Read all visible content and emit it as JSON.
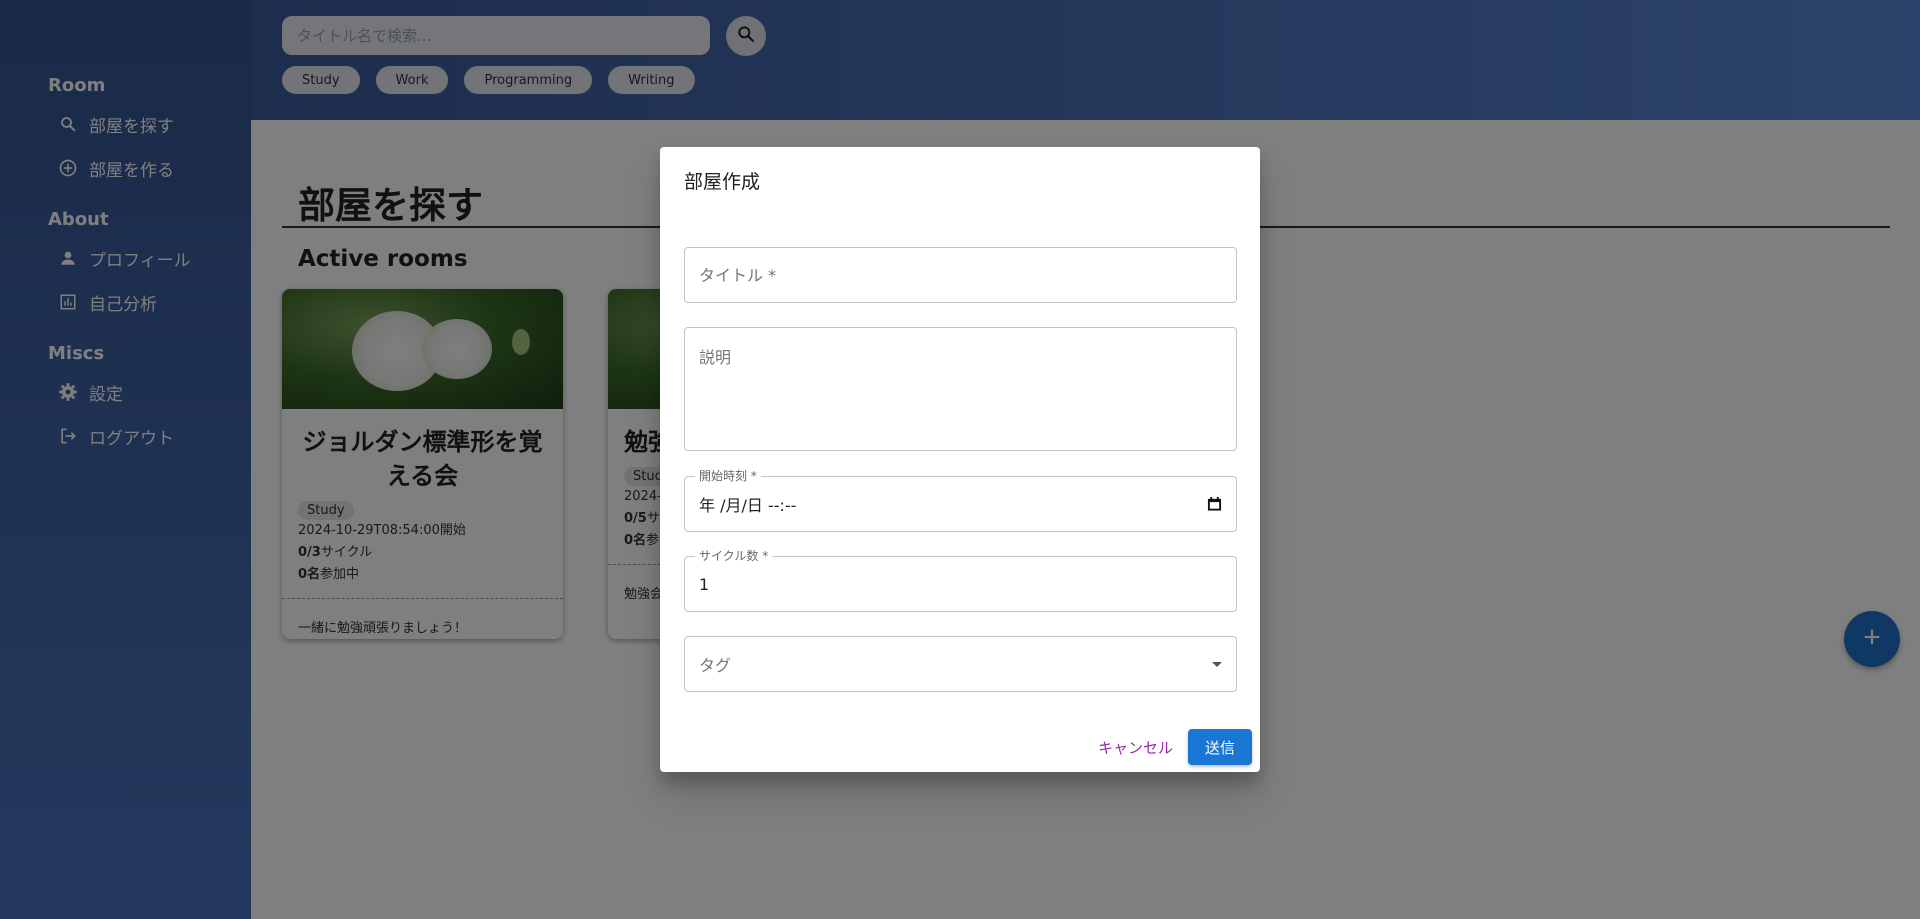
{
  "sidebar": {
    "groups": [
      {
        "heading": "Room",
        "items": [
          {
            "label": "部屋を探す",
            "icon": "search-icon"
          },
          {
            "label": "部屋を作る",
            "icon": "add-circle-icon"
          }
        ]
      },
      {
        "heading": "About",
        "items": [
          {
            "label": "プロフィール",
            "icon": "person-icon"
          },
          {
            "label": "自己分析",
            "icon": "chart-icon"
          }
        ]
      },
      {
        "heading": "Miscs",
        "items": [
          {
            "label": "設定",
            "icon": "gear-icon"
          },
          {
            "label": "ログアウト",
            "icon": "logout-icon"
          }
        ]
      }
    ]
  },
  "topbar": {
    "search_placeholder": "タイトル名で検索...",
    "tags": [
      "Study",
      "Work",
      "Programming",
      "Writing"
    ]
  },
  "main": {
    "page_title": "部屋を探す",
    "section_title": "Active rooms",
    "cards": [
      {
        "title": "ジョルダン標準形を覚える会",
        "tag": "Study",
        "start": "2024-10-29T08:54:00開始",
        "cycles_count": "0/3",
        "cycles_suffix": "サイクル",
        "participants_count": "0名",
        "participants_suffix": "参加中",
        "description": "一緒に勉強頑張りましょう！"
      },
      {
        "title": "勉強",
        "tag": "Stud",
        "start": "2024-",
        "cycles_count": "0/5",
        "cycles_suffix": "サ",
        "participants_count": "0名",
        "participants_suffix": "参",
        "description": "勉強会"
      }
    ]
  },
  "dialog": {
    "title": "部屋作成",
    "title_field_placeholder": "タイトル *",
    "description_placeholder": "説明",
    "start_label": "開始時刻 *",
    "start_value": "年 /月/日 --:--",
    "cycles_label": "サイクル数 *",
    "cycles_value": "1",
    "tag_placeholder": "タグ",
    "cancel_label": "キャンセル",
    "submit_label": "送信"
  },
  "colors": {
    "primary": "#1976d2",
    "cancel": "#9c27b0",
    "sidebar": "#3a5c9e"
  }
}
